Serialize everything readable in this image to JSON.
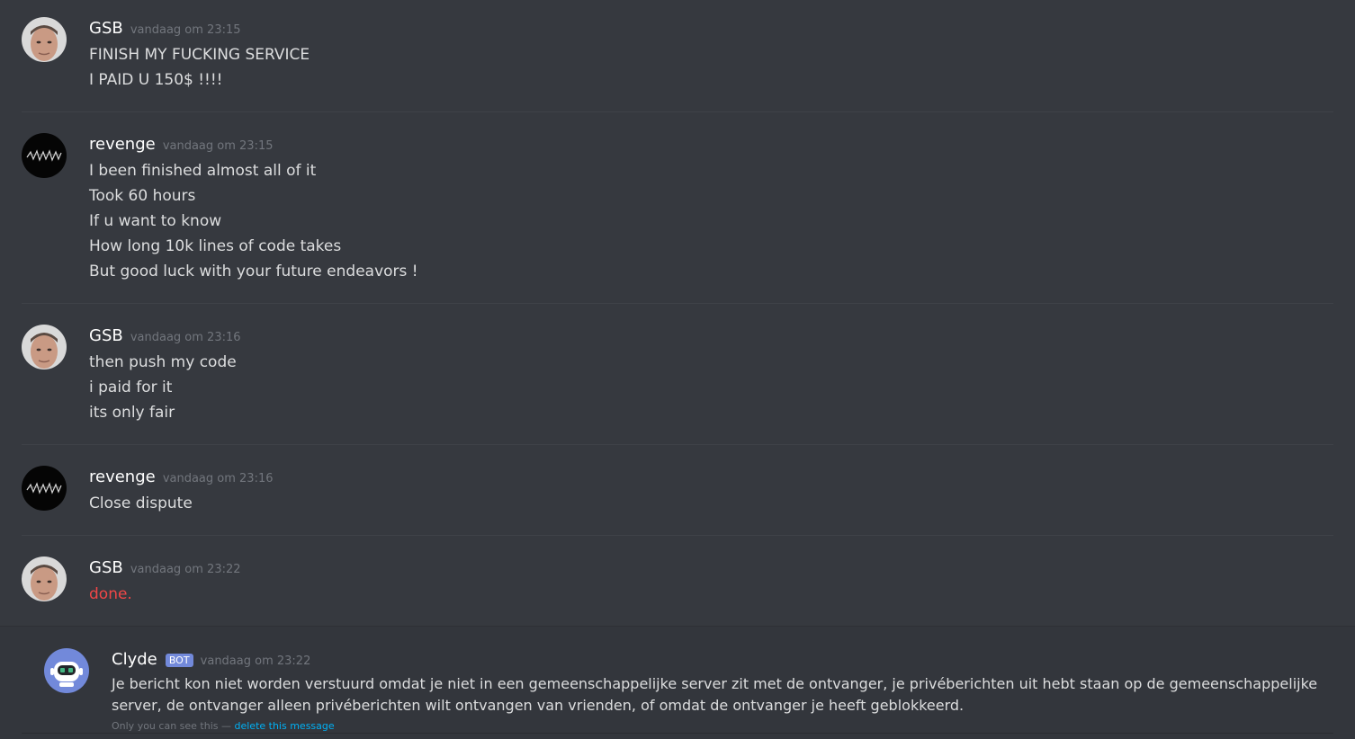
{
  "colors": {
    "background": "#36393f",
    "username": "#ffffff",
    "timestamp": "#72767d",
    "message_text": "#dcddde",
    "red_text": "#f04747",
    "bot_tag": "#7289da",
    "link": "#00b0f4"
  },
  "messages": [
    {
      "author": "GSB",
      "avatar": "gsb-avatar",
      "timestamp": "vandaag om 23:15",
      "lines": [
        "FINISH MY FUCKING SERVICE",
        "I PAID U 150$ !!!!"
      ]
    },
    {
      "author": "revenge",
      "avatar": "revenge-avatar",
      "timestamp": "vandaag om 23:15",
      "lines": [
        "I been finished almost all of it",
        "Took 60 hours",
        "If u want to know",
        "How long 10k lines of code takes",
        "But good luck with your future endeavors !"
      ]
    },
    {
      "author": "GSB",
      "avatar": "gsb-avatar",
      "timestamp": "vandaag om 23:16",
      "lines": [
        "then push my code",
        "i paid for it",
        "its only fair"
      ]
    },
    {
      "author": "revenge",
      "avatar": "revenge-avatar",
      "timestamp": "vandaag om 23:16",
      "lines": [
        "Close dispute"
      ]
    },
    {
      "author": "GSB",
      "avatar": "gsb-avatar",
      "timestamp": "vandaag om 23:22",
      "lines": [
        "done."
      ]
    }
  ],
  "clyde": {
    "author": "Clyde",
    "tag": "BOT",
    "avatar": "clyde-robot-avatar",
    "timestamp": "vandaag om 23:22",
    "text": "Je bericht kon niet worden verstuurd omdat je niet in een gemeenschappelijke server zit met de ontvanger, je privéberichten uit hebt staan op de gemeenschappelijke server, de ontvanger alleen privéberichten wilt ontvangen van vrienden, of omdat de ontvanger je heeft geblokkeerd.",
    "ephemeral_note": "Only you can see this —",
    "delete_link": "delete this message"
  }
}
